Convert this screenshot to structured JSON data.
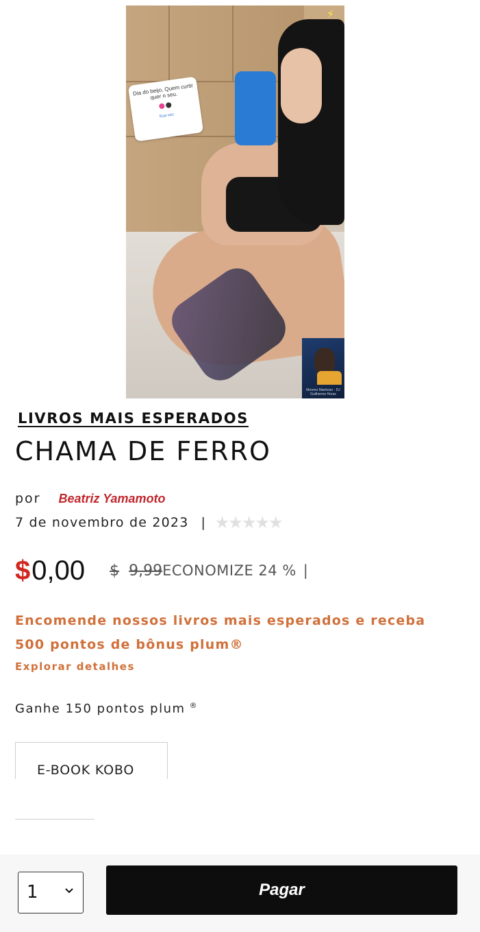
{
  "cover": {
    "story_card_text": "Dia do beijo, Quem curtir quer o seu.",
    "story_card_link": "Sua vez",
    "album_caption": "Moreno Manhoso · DJ Guilherme Horas"
  },
  "product": {
    "category": "LIVROS MAIS ESPERADOS",
    "title": "CHAMA DE FERRO",
    "by_label": "por",
    "author": "Beatriz Yamamoto",
    "date": "7 de novembro de 2023",
    "separator": "|",
    "rating_stars": "★★★★★",
    "rating_value": 0
  },
  "price": {
    "currency_symbol": "$",
    "current": "0,00",
    "old_currency": "$",
    "old_price": "9,99",
    "economize": "ECONOMIZE 24 %",
    "pipe": "|"
  },
  "promo": {
    "text": "Encomende nossos livros mais esperados e receba 500 pontos de bônus plum®",
    "explore_link": "Explorar detalhes"
  },
  "points": {
    "text": "Ganhe 150 pontos plum",
    "mark": "®"
  },
  "format": {
    "label": "E-BOOK KOBO"
  },
  "purchase": {
    "quantity": "1",
    "pay_label": "Pagar"
  },
  "colors": {
    "accent_red": "#d0271e",
    "author_red": "#c0272d",
    "promo_orange": "#d0703a",
    "pay_button": "#0d0d0d"
  }
}
